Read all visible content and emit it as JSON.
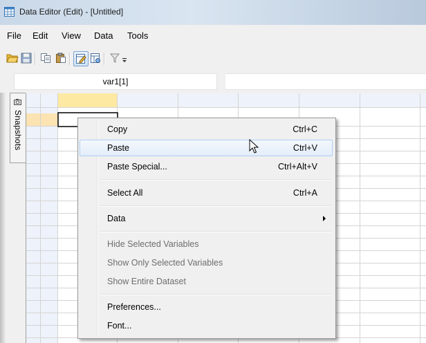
{
  "window": {
    "title": "Data Editor (Edit) - [Untitled]"
  },
  "menu": {
    "items": [
      "File",
      "Edit",
      "View",
      "Data",
      "Tools"
    ]
  },
  "toolbar": {
    "icons": [
      "open-folder-icon",
      "save-icon",
      "copy-icon",
      "paste-icon",
      "edit-mode-icon",
      "browse-mode-icon",
      "filter-icon",
      "toolbar-overflow-icon"
    ]
  },
  "varbar": {
    "cell_name": "var1[1]"
  },
  "snapshots": {
    "label": "Snapshots"
  },
  "context_menu": {
    "items": [
      {
        "label": "Copy",
        "shortcut": "Ctrl+C"
      },
      {
        "label": "Paste",
        "shortcut": "Ctrl+V"
      },
      {
        "label": "Paste Special...",
        "shortcut": "Ctrl+Alt+V"
      },
      {
        "label": "Select All",
        "shortcut": "Ctrl+A"
      },
      {
        "label": "Data"
      },
      {
        "label": "Hide Selected Variables"
      },
      {
        "label": "Show Only Selected Variables"
      },
      {
        "label": "Show Entire Dataset"
      },
      {
        "label": "Preferences..."
      },
      {
        "label": "Font..."
      }
    ],
    "hover_item": "Paste"
  },
  "colors": {
    "grid_line": "#d4d4d4",
    "header_bg": "#eef2fa",
    "selected_header": "#fde9a2",
    "hover_bg": "#e3edf9",
    "hover_border": "#aecff7",
    "disabled_text": "#6d6d6d"
  }
}
